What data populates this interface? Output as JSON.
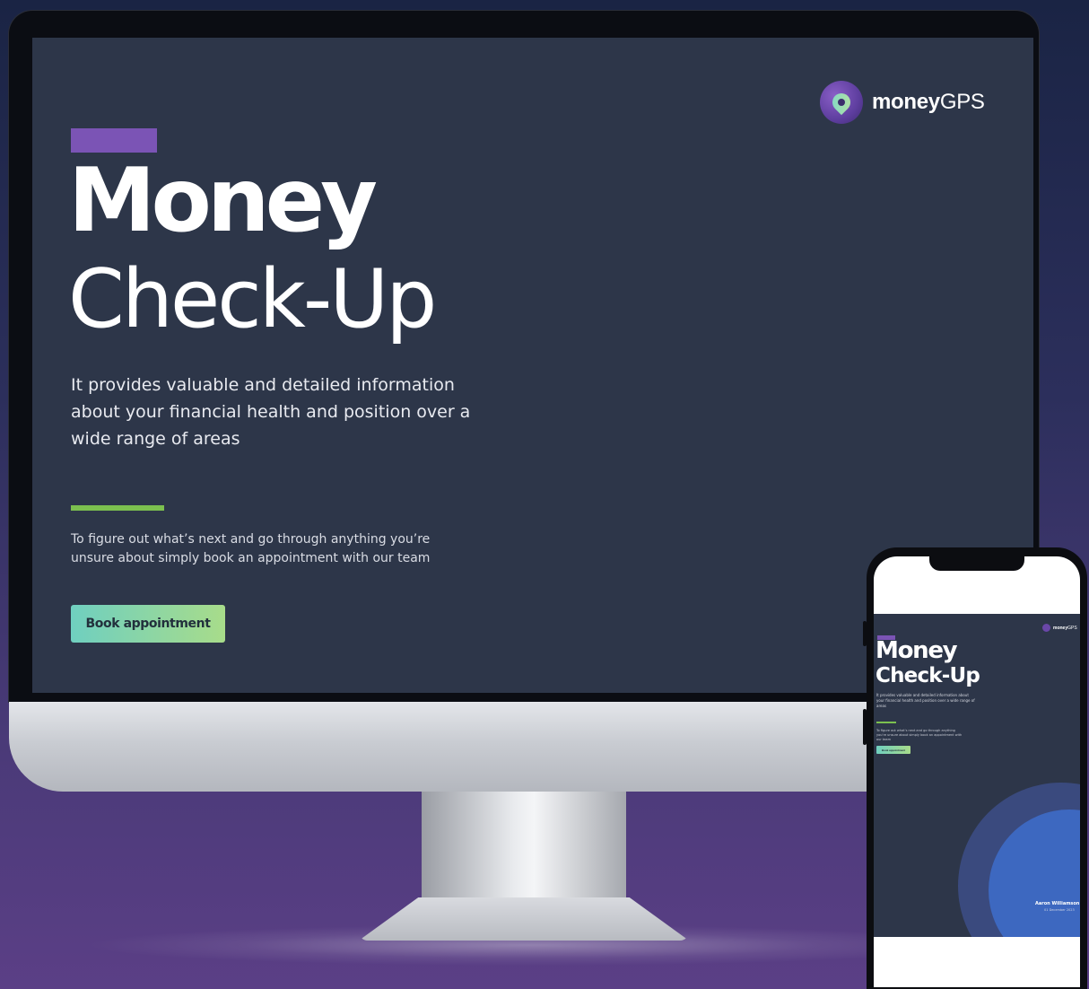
{
  "desktop": {
    "logo": {
      "text_bold": "money",
      "text_regular": "GPS",
      "icon": "map-pin-icon"
    },
    "title_line1": "Money",
    "title_line2": "Check-Up",
    "lede": "It provides valuable and detailed information about your financial health and position over a wide range of areas",
    "cta_text": "To figure out what’s next and go through anything you’re unsure about simply book an appointment with our team",
    "book_button": "Book appointment"
  },
  "mobile": {
    "logo": {
      "text_bold": "money",
      "text_regular": "GPS",
      "icon": "map-pin-icon"
    },
    "title_line1": "Money",
    "title_line2": "Check-Up",
    "lede": "It provides valuable and detailed information about your financial health and position over a wide range of areas",
    "cta_text": "To figure out what’s next and go through anything you’re unsure about simply book an appointment with our team",
    "book_button": "Book appointment",
    "author": "Aaron Williamson",
    "date": "01 December 2023"
  },
  "colors": {
    "screen_bg": "#2d3649",
    "accent_purple": "#7b54b5",
    "accent_green": "#7cc04f",
    "button_gradient_start": "#6fcfc0",
    "button_gradient_end": "#a8dc8a",
    "ring_outer": "#3a4a7e",
    "ring_inner": "#3d68c0"
  }
}
